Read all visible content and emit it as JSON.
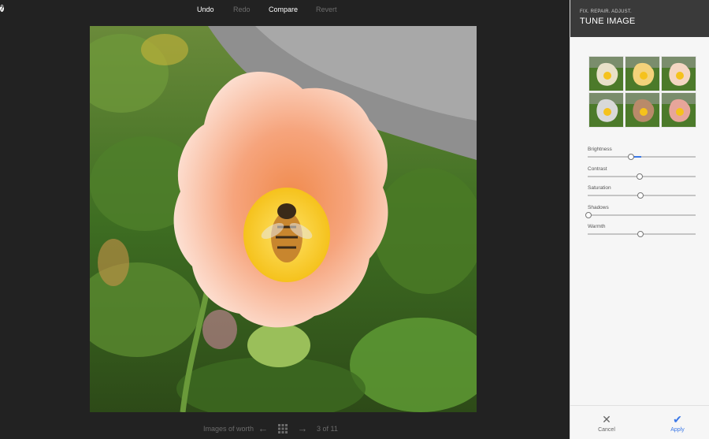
{
  "toolbar": {
    "undo_label": "Undo",
    "redo_label": "Redo",
    "compare_label": "Compare",
    "revert_label": "Revert",
    "help_icon": "?"
  },
  "navigation": {
    "album_title": "Images of worth",
    "prev_icon": "arrow-left-icon",
    "grid_icon": "grid-icon",
    "next_icon": "arrow-right-icon",
    "page_counter": "3 of 11"
  },
  "panel": {
    "subtitle": "FIX. REPAIR. ADJUST.",
    "title": "TUNE IMAGE",
    "presets": [
      {
        "name": "preset-1",
        "tint": "#e8e0c8"
      },
      {
        "name": "preset-2",
        "tint": "#f3d27a"
      },
      {
        "name": "preset-3",
        "tint": "#f4d6c2"
      },
      {
        "name": "preset-4",
        "tint": "#d9d9d9"
      },
      {
        "name": "preset-5",
        "tint": "#b98a6a"
      },
      {
        "name": "preset-6",
        "tint": "#e7a59a"
      }
    ],
    "adjustments": [
      {
        "label": "Brightness",
        "value": 0.4,
        "fill_to": 0.5
      },
      {
        "label": "Contrast",
        "value": 0.48
      },
      {
        "label": "Saturation",
        "value": 0.49
      },
      {
        "label": "Shadows",
        "value": 0.01
      },
      {
        "label": "Warmth",
        "value": 0.49
      }
    ],
    "cancel_label": "Cancel",
    "apply_label": "Apply"
  },
  "colors": {
    "accent": "#3b78e7",
    "background": "#222222",
    "panel_header": "#3a3a3a"
  }
}
